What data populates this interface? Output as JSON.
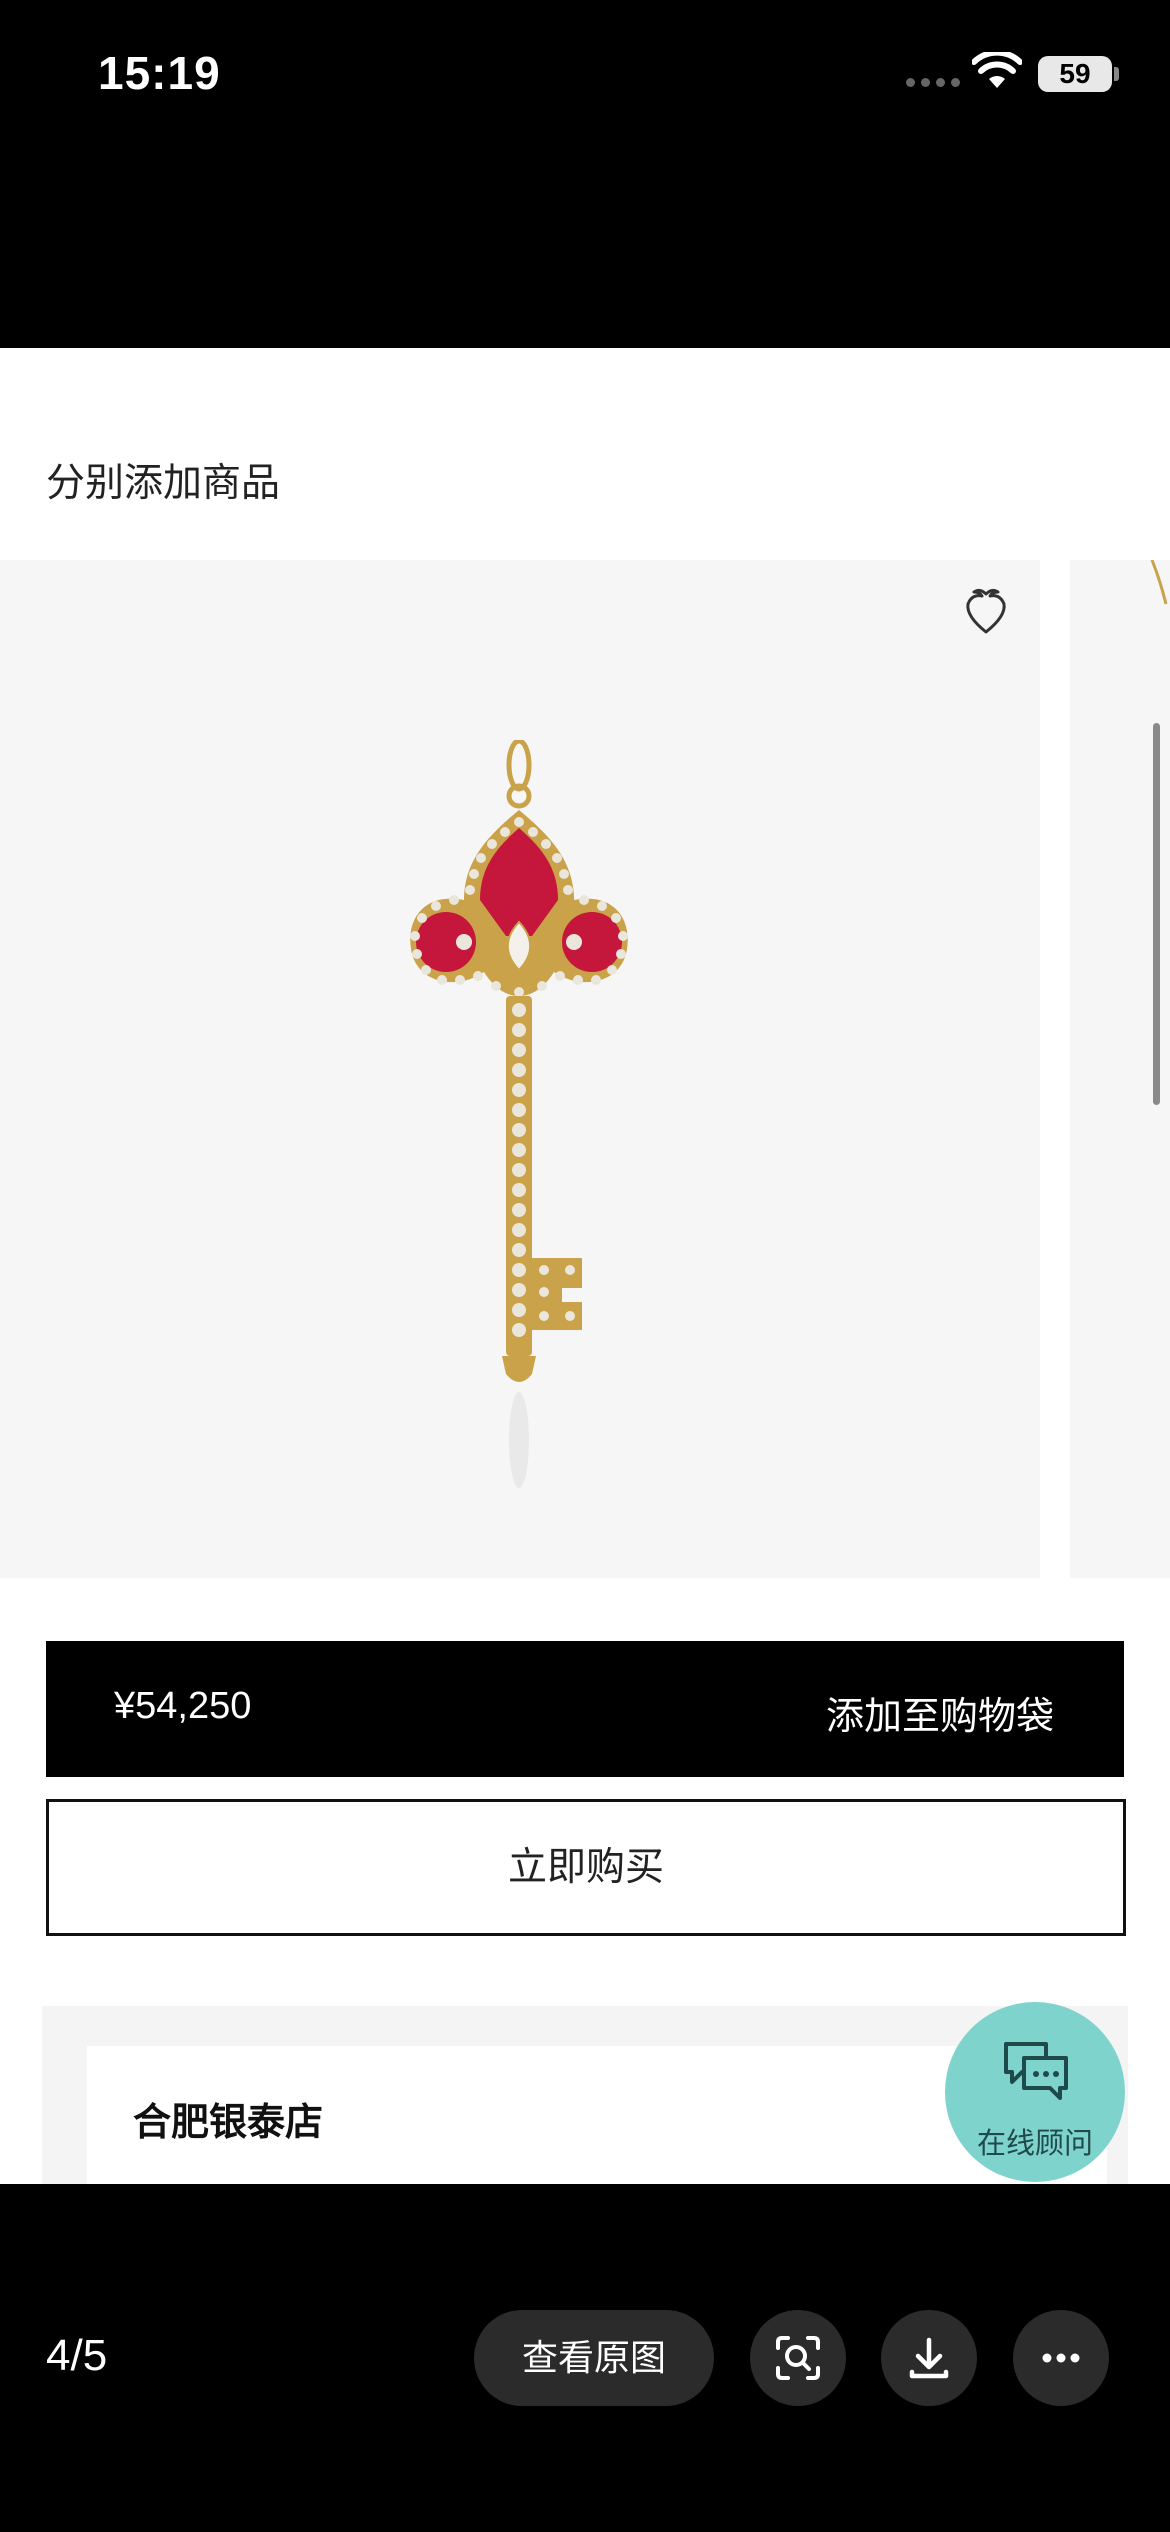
{
  "status_bar": {
    "time": "15:19",
    "battery": "59"
  },
  "icons": {
    "wifi": "wifi-icon",
    "favorite": "heart-icon",
    "chat": "chat-bubbles-icon",
    "scan": "scan-search-icon",
    "download": "download-icon",
    "more": "more-icon"
  },
  "colors": {
    "accent_black": "#000000",
    "chat_button": "#7fd3cd",
    "enamel_red": "#c4173b",
    "gold": "#c9a24a"
  },
  "page": {
    "section_title": "分别添加商品",
    "product": {
      "price": "¥54,250",
      "add_to_bag_label": "添加至购物袋",
      "buy_now_label": "立即购买"
    },
    "store": {
      "name": "合肥银泰店"
    },
    "chat": {
      "label": "在线顾问"
    }
  },
  "viewer": {
    "page_indicator": "4/5",
    "view_original_label": "查看原图"
  }
}
